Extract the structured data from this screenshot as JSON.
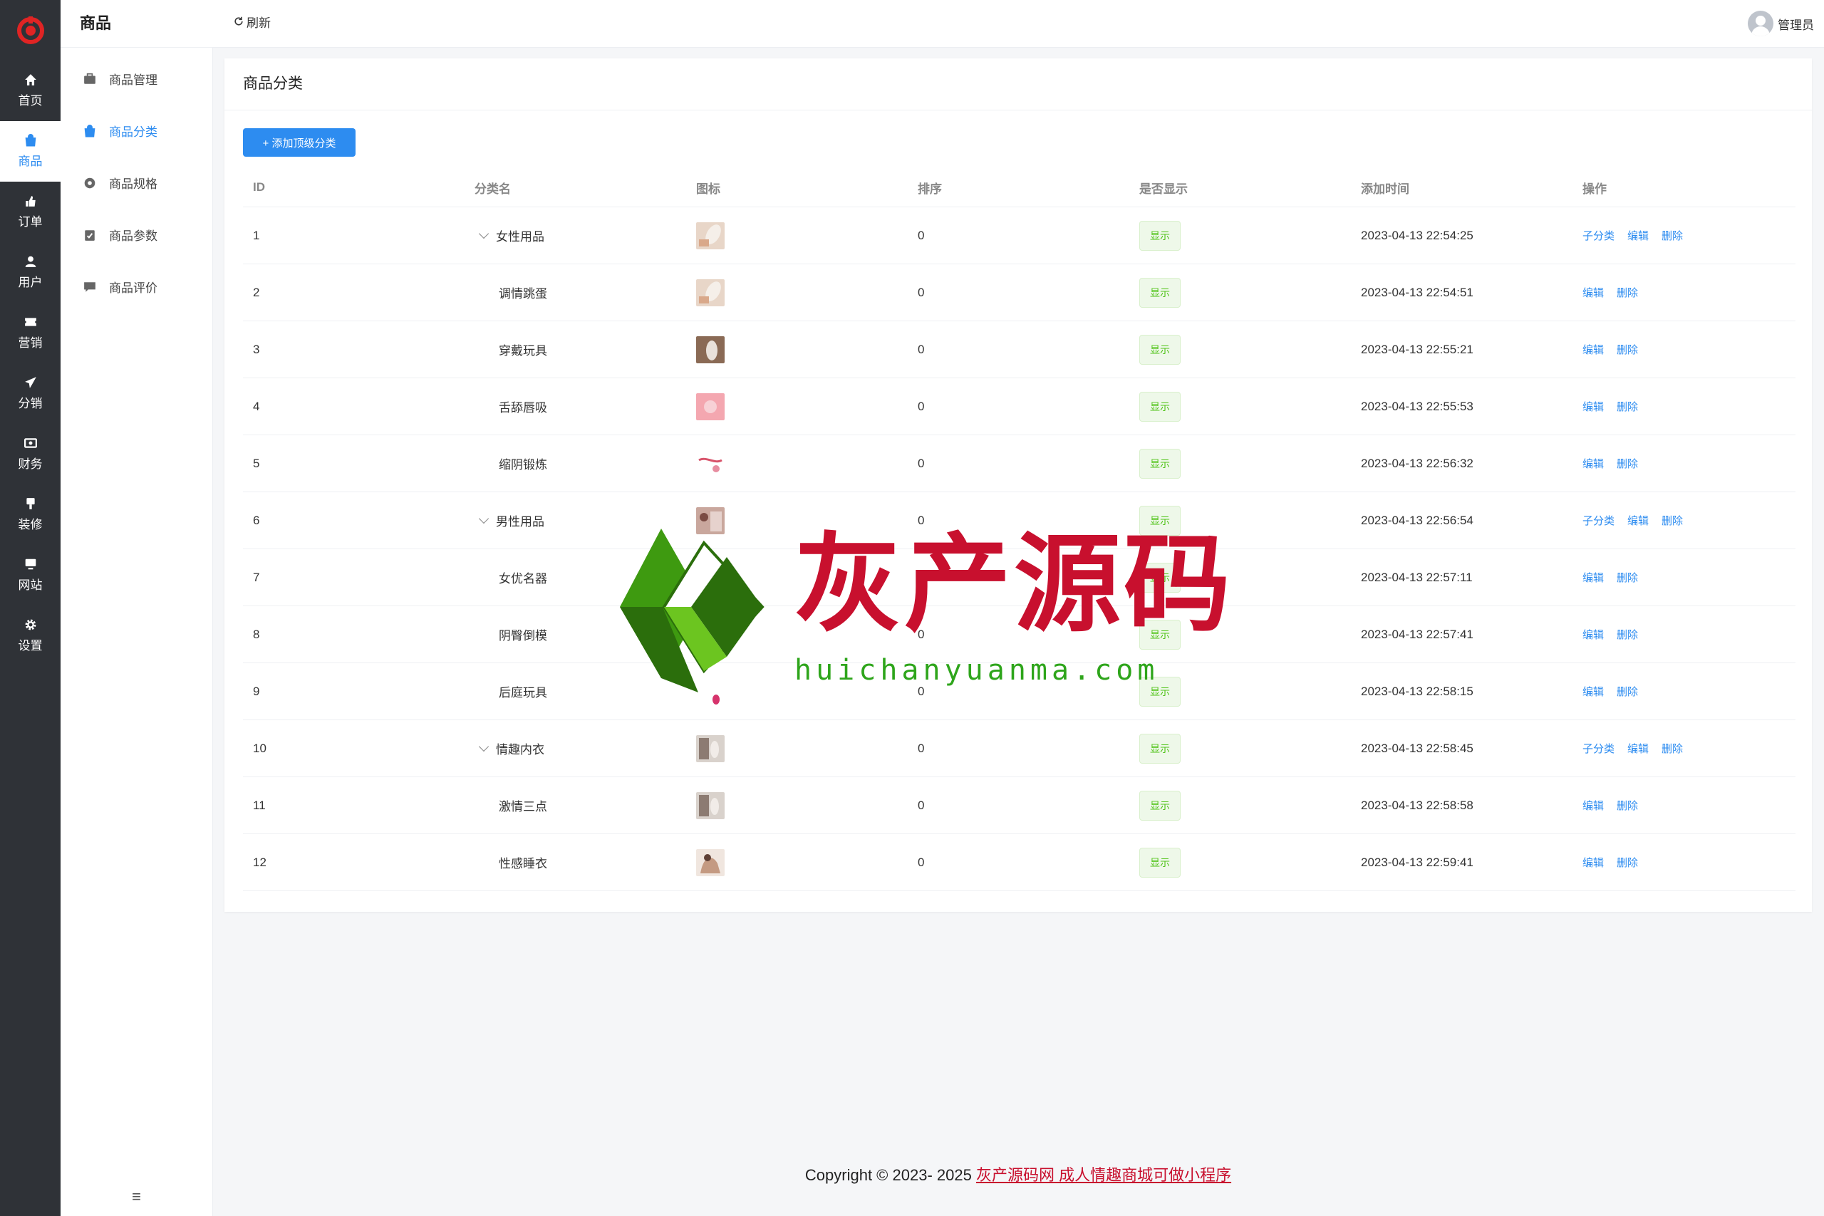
{
  "rail": {
    "items": [
      {
        "label": "首页",
        "icon": "home-icon"
      },
      {
        "label": "商品",
        "icon": "bag-icon"
      },
      {
        "label": "订单",
        "icon": "order-icon"
      },
      {
        "label": "用户",
        "icon": "user-icon"
      },
      {
        "label": "营销",
        "icon": "ticket-icon"
      },
      {
        "label": "分销",
        "icon": "send-icon"
      },
      {
        "label": "财务",
        "icon": "money-icon"
      },
      {
        "label": "装修",
        "icon": "brush-icon"
      },
      {
        "label": "网站",
        "icon": "monitor-icon"
      },
      {
        "label": "设置",
        "icon": "gear-icon"
      }
    ]
  },
  "subnav": {
    "title": "商品",
    "links": [
      {
        "label": "商品管理"
      },
      {
        "label": "商品分类"
      },
      {
        "label": "商品规格"
      },
      {
        "label": "商品参数"
      },
      {
        "label": "商品评价"
      }
    ]
  },
  "topbar": {
    "refresh": "刷新",
    "user": "管理员"
  },
  "card": {
    "title": "商品分类",
    "add_button": "+ 添加顶级分类"
  },
  "table": {
    "headers": [
      "ID",
      "分类名",
      "图标",
      "排序",
      "是否显示",
      "添加时间",
      "操作"
    ],
    "rows": [
      {
        "id": "1",
        "name": "女性用品",
        "sort": "0",
        "show": "显示",
        "time": "2023-04-13 22:54:25"
      },
      {
        "id": "2",
        "name": "调情跳蛋",
        "sort": "0",
        "show": "显示",
        "time": "2023-04-13 22:54:51"
      },
      {
        "id": "3",
        "name": "穿戴玩具",
        "sort": "0",
        "show": "显示",
        "time": "2023-04-13 22:55:21"
      },
      {
        "id": "4",
        "name": "舌舔唇吸",
        "sort": "0",
        "show": "显示",
        "time": "2023-04-13 22:55:53"
      },
      {
        "id": "5",
        "name": "缩阴锻炼",
        "sort": "0",
        "show": "显示",
        "time": "2023-04-13 22:56:32"
      },
      {
        "id": "6",
        "name": "男性用品",
        "sort": "0",
        "show": "显示",
        "time": "2023-04-13 22:56:54"
      },
      {
        "id": "7",
        "name": "女优名器",
        "sort": "0",
        "show": "显示",
        "time": "2023-04-13 22:57:11"
      },
      {
        "id": "8",
        "name": "阴臀倒模",
        "sort": "0",
        "show": "显示",
        "time": "2023-04-13 22:57:41"
      },
      {
        "id": "9",
        "name": "后庭玩具",
        "sort": "0",
        "show": "显示",
        "time": "2023-04-13 22:58:15"
      },
      {
        "id": "10",
        "name": "情趣内衣",
        "sort": "0",
        "show": "显示",
        "time": "2023-04-13 22:58:45"
      },
      {
        "id": "11",
        "name": "激情三点",
        "sort": "0",
        "show": "显示",
        "time": "2023-04-13 22:58:58"
      },
      {
        "id": "12",
        "name": "性感睡衣",
        "sort": "0",
        "show": "显示",
        "time": "2023-04-13 22:59:41"
      }
    ],
    "ops": {
      "child": "子分类",
      "edit": "编辑",
      "delete": "删除"
    }
  },
  "watermark": {
    "title": "灰产源码",
    "url": "huichanyuanma.com"
  },
  "footer": {
    "copyright": "Copyright © 2023- 2025",
    "link": "灰产源码网 成人情趣商城可做小程序"
  },
  "colors": {
    "rail_bg": "#2f3237",
    "accent": "#2d8cf0",
    "tag_green": "#52c41a",
    "watermark_red": "#c8102e"
  }
}
